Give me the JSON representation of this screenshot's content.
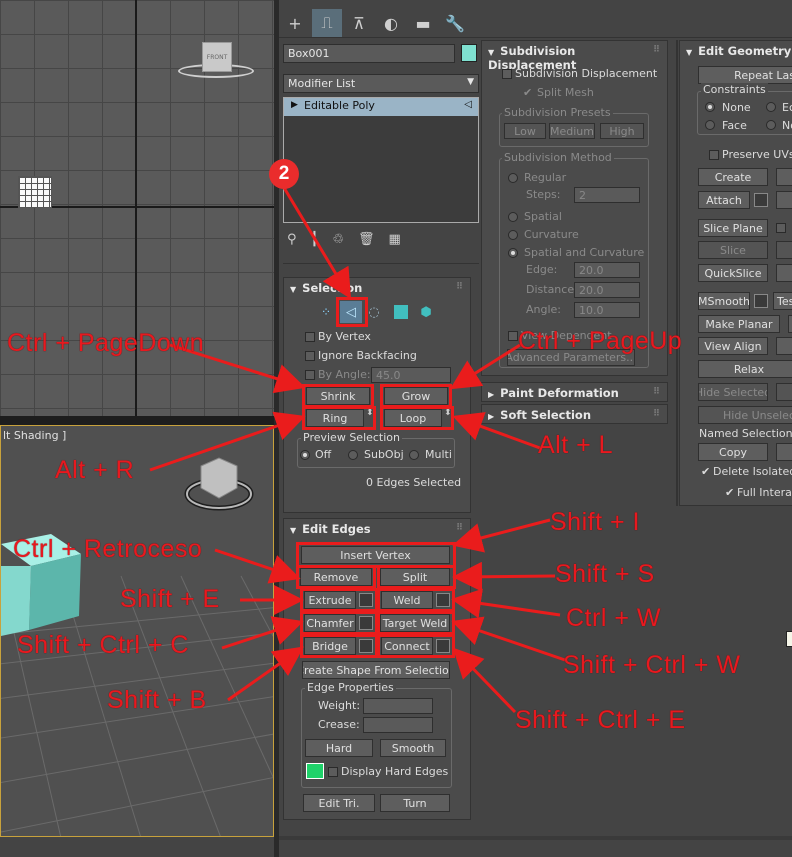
{
  "viewports": {
    "perspective_label": "lt Shading ]",
    "viewcube_top_label": "FRONT"
  },
  "toolbar": {
    "tabs": [
      {
        "icon": "create-plus-icon",
        "glyph": "+"
      },
      {
        "icon": "modify-icon",
        "glyph": "⎍"
      },
      {
        "icon": "hierarchy-icon",
        "glyph": "⊼"
      },
      {
        "icon": "motion-icon",
        "glyph": "◐"
      },
      {
        "icon": "display-icon",
        "glyph": "▬"
      },
      {
        "icon": "utilities-icon",
        "glyph": "🔧"
      }
    ]
  },
  "object": {
    "name": "Box001",
    "color": "#7fe0d0",
    "modifier_list": "Modifier List",
    "stack_item": "Editable Poly"
  },
  "selection": {
    "title": "Selection",
    "by_vertex": "By Vertex",
    "ignore_backfacing": "Ignore Backfacing",
    "by_angle": "By Angle:",
    "by_angle_value": "45.0",
    "shrink": "Shrink",
    "grow": "Grow",
    "ring": "Ring",
    "loop": "Loop",
    "preview_selection": "Preview Selection",
    "preview_options": [
      "Off",
      "SubObj",
      "Multi"
    ],
    "status": "0 Edges Selected"
  },
  "edit_edges": {
    "title": "Edit Edges",
    "insert_vertex": "Insert Vertex",
    "remove": "Remove",
    "split": "Split",
    "extrude": "Extrude",
    "weld": "Weld",
    "chamfer": "Chamfer",
    "target_weld": "Target Weld",
    "bridge": "Bridge",
    "connect": "Connect",
    "create_shape": "Create Shape From Selection",
    "edge_properties": "Edge Properties",
    "weight": "Weight:",
    "crease": "Crease:",
    "hard": "Hard",
    "smooth": "Smooth",
    "display_hard_edges": "Display Hard Edges",
    "edit_tri": "Edit Tri.",
    "turn": "Turn",
    "hard_edge_color": "#1fd26a"
  },
  "subdivision_displacement": {
    "title": "Subdivision Displacement",
    "checkbox": "Subdivision Displacement",
    "split_mesh": "Split Mesh",
    "presets_title": "Subdivision Presets",
    "presets": [
      "Low",
      "Medium",
      "High"
    ],
    "method_title": "Subdivision Method",
    "regular": "Regular",
    "steps": "Steps:",
    "steps_value": "2",
    "spatial": "Spatial",
    "curvature": "Curvature",
    "spatial_curvature": "Spatial and Curvature",
    "edge": "Edge:",
    "edge_value": "20.0",
    "distance": "Distance:",
    "distance_value": "20.0",
    "angle": "Angle:",
    "angle_value": "10.0",
    "view_dependent": "View Dependent",
    "advanced": "Advanced Parameters..."
  },
  "paint_deformation": {
    "title": "Paint Deformation"
  },
  "soft_selection": {
    "title": "Soft Selection"
  },
  "edit_geometry": {
    "title": "Edit Geometry",
    "repeat_last": "Repeat Las",
    "constraints": "Constraints",
    "none": "None",
    "face": "Face",
    "edge_c": "Ec",
    "normal_c": "No",
    "preserve_uvs": "Preserve UVs",
    "create": "Create",
    "attach": "Attach",
    "slice_plane": "Slice Plane",
    "slice": "Slice",
    "quickslice": "QuickSlice",
    "msmooth": "MSmooth",
    "tess": "Tes",
    "make_planar": "Make Planar",
    "view_align": "View Align",
    "relax": "Relax",
    "hide_selected": "Hide Selected",
    "hide_unselected": "Hide Unselec",
    "named_selections": "Named Selections:",
    "copy": "Copy",
    "delete_isolated": "Delete Isolated V",
    "full_interactivity": "Full Interac"
  },
  "annotations": {
    "step_badge": "2",
    "ctrl_pagedown": "Ctrl + PageDown",
    "ctrl_pageup": "Ctrl + PageUp",
    "alt_r": "Alt + R",
    "alt_l": "Alt + L",
    "shift_i": "Shift + I",
    "ctrl_retroceso": "Ctrl + Retroceso",
    "shift_s": "Shift + S",
    "shift_e": "Shift + E",
    "ctrl_w": "Ctrl + W",
    "shift_ctrl_c": "Shift + Ctrl + C",
    "shift_ctrl_w": "Shift + Ctrl + W",
    "shift_b": "Shift + B",
    "shift_ctrl_e": "Shift + Ctrl + E",
    "color": "#e8191f"
  }
}
